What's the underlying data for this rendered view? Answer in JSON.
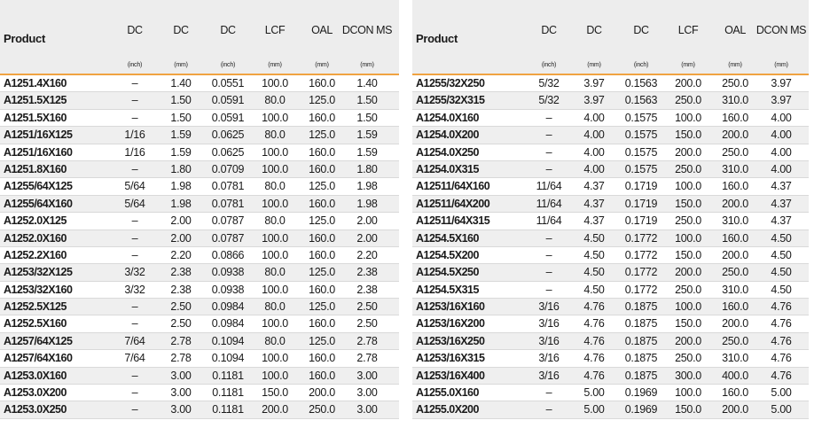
{
  "header": {
    "product": "Product",
    "columns": [
      {
        "label": "DC",
        "unit": "(inch)"
      },
      {
        "label": "DC",
        "unit": "(mm)"
      },
      {
        "label": "DC",
        "unit": "(inch)"
      },
      {
        "label": "LCF",
        "unit": "(mm)"
      },
      {
        "label": "OAL",
        "unit": "(mm)"
      },
      {
        "label": "DCON MS",
        "unit": "(mm)"
      }
    ]
  },
  "tables": [
    {
      "rows": [
        [
          "A1251.4X160",
          "–",
          "1.40",
          "0.0551",
          "100.0",
          "160.0",
          "1.40"
        ],
        [
          "A1251.5X125",
          "–",
          "1.50",
          "0.0591",
          "80.0",
          "125.0",
          "1.50"
        ],
        [
          "A1251.5X160",
          "–",
          "1.50",
          "0.0591",
          "100.0",
          "160.0",
          "1.50"
        ],
        [
          "A1251/16X125",
          "1/16",
          "1.59",
          "0.0625",
          "80.0",
          "125.0",
          "1.59"
        ],
        [
          "A1251/16X160",
          "1/16",
          "1.59",
          "0.0625",
          "100.0",
          "160.0",
          "1.59"
        ],
        [
          "A1251.8X160",
          "–",
          "1.80",
          "0.0709",
          "100.0",
          "160.0",
          "1.80"
        ],
        [
          "A1255/64X125",
          "5/64",
          "1.98",
          "0.0781",
          "80.0",
          "125.0",
          "1.98"
        ],
        [
          "A1255/64X160",
          "5/64",
          "1.98",
          "0.0781",
          "100.0",
          "160.0",
          "1.98"
        ],
        [
          "A1252.0X125",
          "–",
          "2.00",
          "0.0787",
          "80.0",
          "125.0",
          "2.00"
        ],
        [
          "A1252.0X160",
          "–",
          "2.00",
          "0.0787",
          "100.0",
          "160.0",
          "2.00"
        ],
        [
          "A1252.2X160",
          "–",
          "2.20",
          "0.0866",
          "100.0",
          "160.0",
          "2.20"
        ],
        [
          "A1253/32X125",
          "3/32",
          "2.38",
          "0.0938",
          "80.0",
          "125.0",
          "2.38"
        ],
        [
          "A1253/32X160",
          "3/32",
          "2.38",
          "0.0938",
          "100.0",
          "160.0",
          "2.38"
        ],
        [
          "A1252.5X125",
          "–",
          "2.50",
          "0.0984",
          "80.0",
          "125.0",
          "2.50"
        ],
        [
          "A1252.5X160",
          "–",
          "2.50",
          "0.0984",
          "100.0",
          "160.0",
          "2.50"
        ],
        [
          "A1257/64X125",
          "7/64",
          "2.78",
          "0.1094",
          "80.0",
          "125.0",
          "2.78"
        ],
        [
          "A1257/64X160",
          "7/64",
          "2.78",
          "0.1094",
          "100.0",
          "160.0",
          "2.78"
        ],
        [
          "A1253.0X160",
          "–",
          "3.00",
          "0.1181",
          "100.0",
          "160.0",
          "3.00"
        ],
        [
          "A1253.0X200",
          "–",
          "3.00",
          "0.1181",
          "150.0",
          "200.0",
          "3.00"
        ],
        [
          "A1253.0X250",
          "–",
          "3.00",
          "0.1181",
          "200.0",
          "250.0",
          "3.00"
        ]
      ]
    },
    {
      "rows": [
        [
          "A1255/32X250",
          "5/32",
          "3.97",
          "0.1563",
          "200.0",
          "250.0",
          "3.97"
        ],
        [
          "A1255/32X315",
          "5/32",
          "3.97",
          "0.1563",
          "250.0",
          "310.0",
          "3.97"
        ],
        [
          "A1254.0X160",
          "–",
          "4.00",
          "0.1575",
          "100.0",
          "160.0",
          "4.00"
        ],
        [
          "A1254.0X200",
          "–",
          "4.00",
          "0.1575",
          "150.0",
          "200.0",
          "4.00"
        ],
        [
          "A1254.0X250",
          "–",
          "4.00",
          "0.1575",
          "200.0",
          "250.0",
          "4.00"
        ],
        [
          "A1254.0X315",
          "–",
          "4.00",
          "0.1575",
          "250.0",
          "310.0",
          "4.00"
        ],
        [
          "A12511/64X160",
          "11/64",
          "4.37",
          "0.1719",
          "100.0",
          "160.0",
          "4.37"
        ],
        [
          "A12511/64X200",
          "11/64",
          "4.37",
          "0.1719",
          "150.0",
          "200.0",
          "4.37"
        ],
        [
          "A12511/64X315",
          "11/64",
          "4.37",
          "0.1719",
          "250.0",
          "310.0",
          "4.37"
        ],
        [
          "A1254.5X160",
          "–",
          "4.50",
          "0.1772",
          "100.0",
          "160.0",
          "4.50"
        ],
        [
          "A1254.5X200",
          "–",
          "4.50",
          "0.1772",
          "150.0",
          "200.0",
          "4.50"
        ],
        [
          "A1254.5X250",
          "–",
          "4.50",
          "0.1772",
          "200.0",
          "250.0",
          "4.50"
        ],
        [
          "A1254.5X315",
          "–",
          "4.50",
          "0.1772",
          "250.0",
          "310.0",
          "4.50"
        ],
        [
          "A1253/16X160",
          "3/16",
          "4.76",
          "0.1875",
          "100.0",
          "160.0",
          "4.76"
        ],
        [
          "A1253/16X200",
          "3/16",
          "4.76",
          "0.1875",
          "150.0",
          "200.0",
          "4.76"
        ],
        [
          "A1253/16X250",
          "3/16",
          "4.76",
          "0.1875",
          "200.0",
          "250.0",
          "4.76"
        ],
        [
          "A1253/16X315",
          "3/16",
          "4.76",
          "0.1875",
          "250.0",
          "310.0",
          "4.76"
        ],
        [
          "A1253/16X400",
          "3/16",
          "4.76",
          "0.1875",
          "300.0",
          "400.0",
          "4.76"
        ],
        [
          "A1255.0X160",
          "–",
          "5.00",
          "0.1969",
          "100.0",
          "160.0",
          "5.00"
        ],
        [
          "A1255.0X200",
          "–",
          "5.00",
          "0.1969",
          "150.0",
          "200.0",
          "5.00"
        ]
      ]
    }
  ]
}
